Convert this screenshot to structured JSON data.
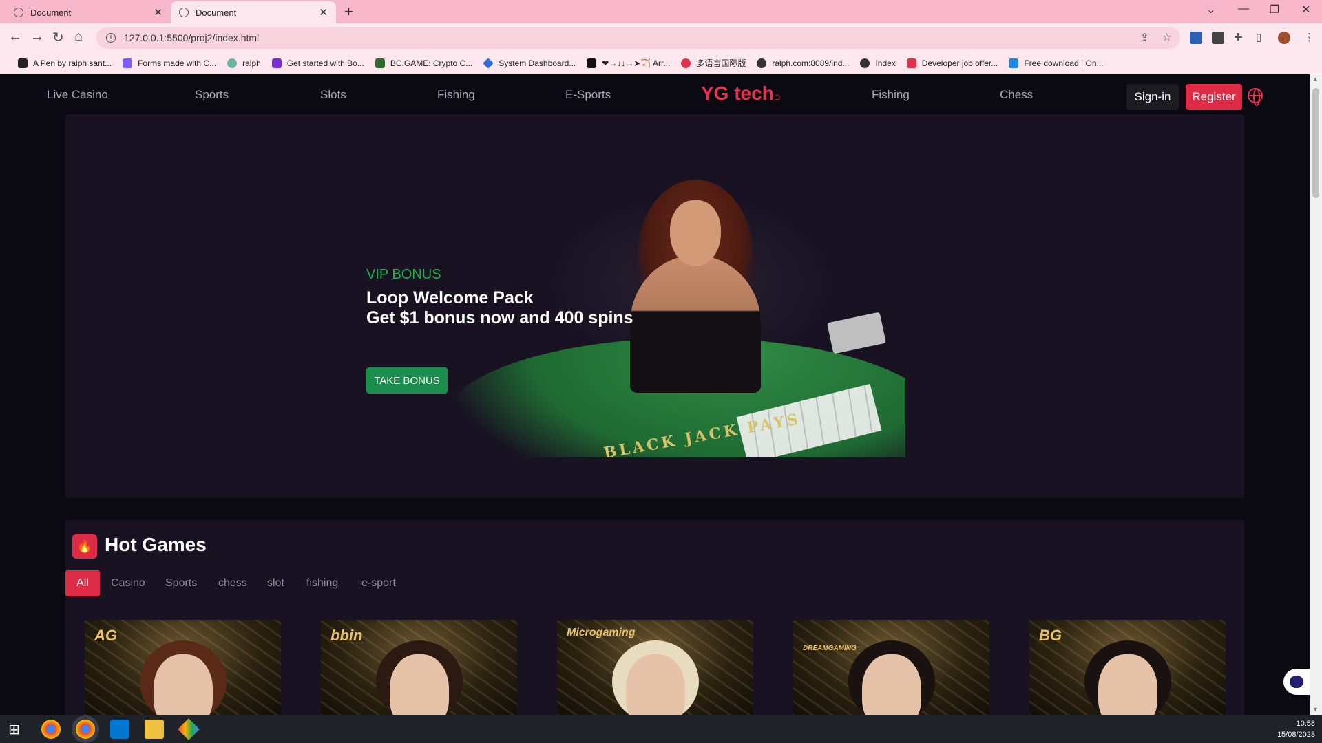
{
  "browser": {
    "tabs": [
      {
        "title": "Document",
        "active": false
      },
      {
        "title": "Document",
        "active": true
      }
    ],
    "url": "127.0.0.1:5500/proj2/index.html",
    "bookmarks": [
      {
        "label": "A Pen by ralph sant...",
        "color": "#222222"
      },
      {
        "label": "Forms made with C...",
        "color": "#7a5cff"
      },
      {
        "label": "ralph",
        "color": "#6bb3a3"
      },
      {
        "label": "Get started with Bo...",
        "color": "#7a2bd8"
      },
      {
        "label": "BC.GAME: Crypto C...",
        "color": "#2a6b2a"
      },
      {
        "label": "System Dashboard...",
        "color": "#2d6cdf"
      },
      {
        "label": "❤→↓↓→➤🏹 Arr...",
        "color": "#111111"
      },
      {
        "label": "多语言国际版",
        "color": "#e0314b"
      },
      {
        "label": "ralph.com:8089/ind...",
        "color": "#333333"
      },
      {
        "label": "Index",
        "color": "#333333"
      },
      {
        "label": "Developer job offer...",
        "color": "#e0314b"
      },
      {
        "label": "Free download | On...",
        "color": "#1e88e5"
      }
    ]
  },
  "nav": {
    "links": [
      "Live Casino",
      "Sports",
      "Slots",
      "Fishing",
      "E-Sports"
    ],
    "logo": "YG tech",
    "links_right": [
      "Fishing",
      "Chess"
    ],
    "signin": "Sign-in",
    "register": "Register"
  },
  "hero": {
    "tag": "VIP BONUS",
    "line1": "Loop Welcome Pack",
    "line2": "Get $1 bonus now and 400 spins",
    "button": "TAKE BONUS",
    "table_text": "BLACK JACK PAYS"
  },
  "hot": {
    "title": "Hot Games",
    "filters": [
      "All",
      "Casino",
      "Sports",
      "chess",
      "slot",
      "fishing",
      "e-sport"
    ],
    "active_filter": "All",
    "games": [
      {
        "brand": "AG"
      },
      {
        "brand": "bbin"
      },
      {
        "brand": "Microgaming"
      },
      {
        "brand": "DREAMGAMING"
      },
      {
        "brand": "BG"
      }
    ]
  },
  "taskbar": {
    "time": "10:58",
    "date": "15/08/2023"
  },
  "colors": {
    "accent": "#de2b45",
    "vip_green": "#1bb34a",
    "take_bonus": "#1a8f4d",
    "tabstrip": "#f7b6c9"
  }
}
